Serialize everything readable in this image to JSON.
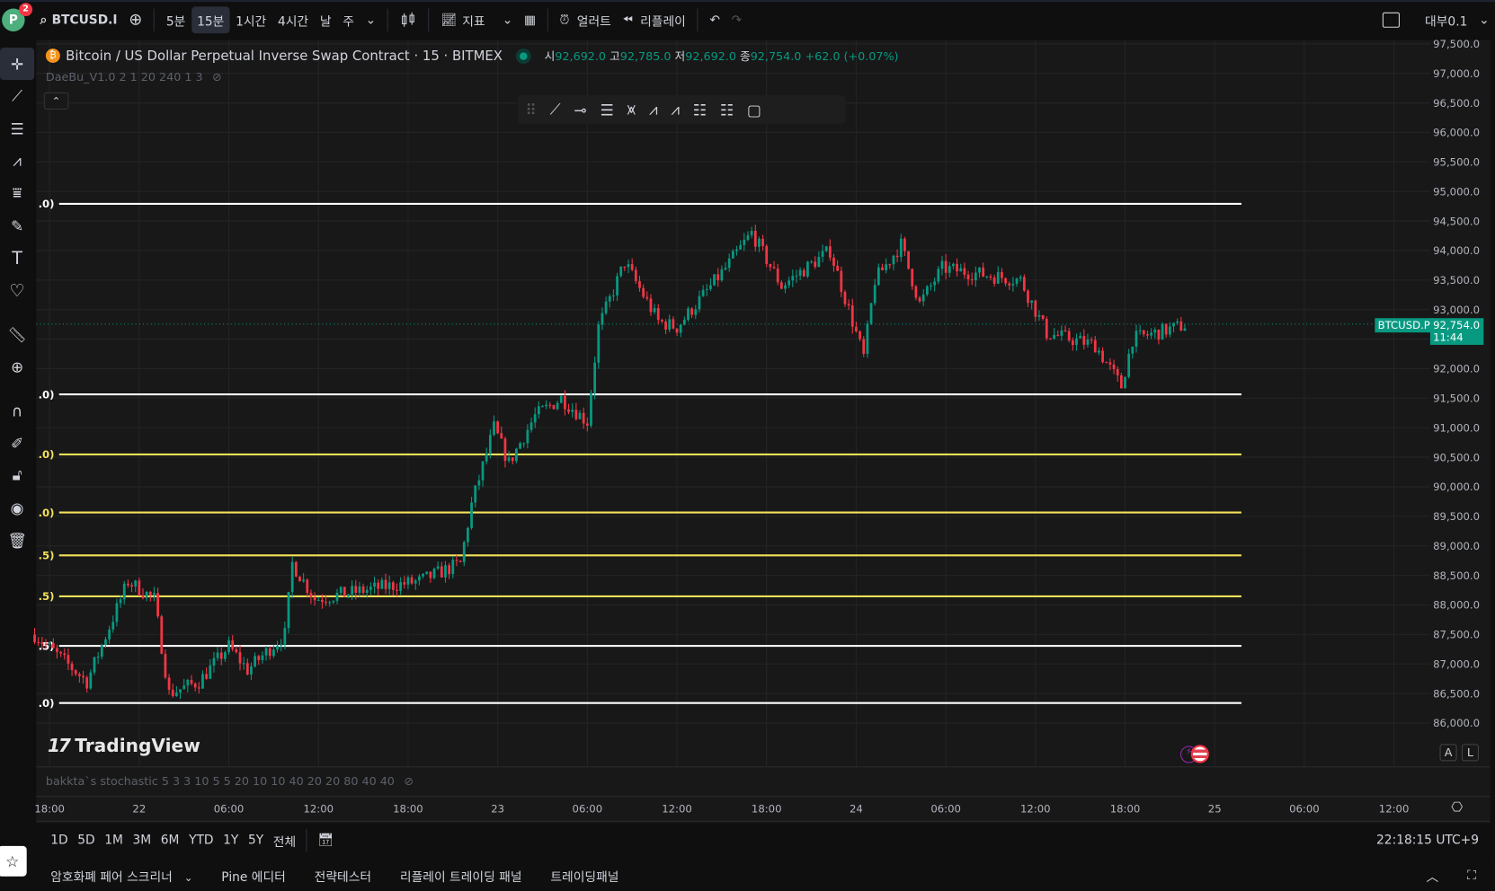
{
  "topbar": {
    "avatar": "P",
    "badge": "2",
    "symbol": "BTCUSD.I",
    "intervals": [
      "5분",
      "15분",
      "1시간",
      "4시간",
      "날",
      "주"
    ],
    "active_interval": "15분",
    "indicators": "지표",
    "alert": "얼러트",
    "replay": "리플레이",
    "layout_name": "대부0.1"
  },
  "legend": {
    "title": "Bitcoin / US Dollar Perpetual Inverse Swap Contract · 15 · BITMEX",
    "o_label": "시",
    "o": "92,692.0",
    "h_label": "고",
    "h": "92,785.0",
    "l_label": "저",
    "l": "92,692.0",
    "c_label": "종",
    "c": "92,754.0",
    "change": "+62.0 (+0.07%)"
  },
  "indicator1": "DaeBu_V1.0 2 1 20 240 1 3",
  "indicator2": "bakkta`s stochastic 5 3 3 10 5 5 20 10 10 40 20 20 80 40 40",
  "watermark": "TradingView",
  "price_label": {
    "symbol": "BTCUSD.P",
    "price": "92,754.0",
    "countdown": "11:44"
  },
  "scale_buttons": [
    "A",
    "L"
  ],
  "range_buttons": [
    "1D",
    "5D",
    "1M",
    "3M",
    "6M",
    "YTD",
    "1Y",
    "5Y",
    "전체"
  ],
  "clock": "22:18:15 UTC+9",
  "bottom_tabs": [
    "암호화폐 페어 스크리너",
    "Pine 에디터",
    "전략테스터",
    "리플레이 트레이딩 패널",
    "트레이딩패널"
  ],
  "colors": {
    "up": "#089981",
    "down": "#f23645",
    "bg": "#181818",
    "grid": "#242424",
    "level_white": "#ffffff",
    "level_yellow": "#f5e15a"
  },
  "chart_data": {
    "type": "candlestick",
    "interval": "15",
    "y_ticks": [
      "97,500.0",
      "97,000.0",
      "96,500.0",
      "96,000.0",
      "95,500.0",
      "95,000.0",
      "94,500.0",
      "94,000.0",
      "93,500.0",
      "93,000.0",
      "92,500.0",
      "92,000.0",
      "91,500.0",
      "91,000.0",
      "90,500.0",
      "90,000.0",
      "89,500.0",
      "89,000.0",
      "88,500.0",
      "88,000.0",
      "87,500.0",
      "87,000.0",
      "86,500.0",
      "86,000.0"
    ],
    "ylim": [
      86000,
      97500
    ],
    "x_ticks": [
      "18:00",
      "22",
      "06:00",
      "12:00",
      "18:00",
      "23",
      "06:00",
      "12:00",
      "18:00",
      "24",
      "06:00",
      "12:00",
      "18:00",
      "25",
      "06:00",
      "12:00"
    ],
    "last_price": 92754,
    "levels": [
      {
        "price": 94790,
        "color": "white",
        "label": ".0)"
      },
      {
        "price": 91565,
        "color": "white",
        "label": ".0)"
      },
      {
        "price": 90548,
        "color": "yellow",
        "label": ".0)"
      },
      {
        "price": 89565,
        "color": "yellow",
        "label": ".0)"
      },
      {
        "price": 88839,
        "color": "yellow",
        "label": ".5)"
      },
      {
        "price": 88145,
        "color": "yellow",
        "label": ".5)"
      },
      {
        "price": 87306,
        "color": "white",
        "label": ".5)"
      },
      {
        "price": 86339,
        "color": "white",
        "label": ".0)"
      }
    ],
    "approx_close_path": [
      [
        "21 17:00",
        87500
      ],
      [
        "21 20:30",
        86700
      ],
      [
        "21 23:15",
        88400
      ],
      [
        "22 01:00",
        88100
      ],
      [
        "22 02:00",
        86500
      ],
      [
        "22 04:00",
        86700
      ],
      [
        "22 06:00",
        87300
      ],
      [
        "22 07:15",
        86900
      ],
      [
        "22 09:45",
        87500
      ],
      [
        "22 10:15",
        88700
      ],
      [
        "22 11:45",
        88100
      ],
      [
        "22 16:15",
        88300
      ],
      [
        "22 18:45",
        88400
      ],
      [
        "22 21:30",
        88700
      ],
      [
        "22 22:15",
        89700
      ],
      [
        "22 23:45",
        91000
      ],
      [
        "23 00:45",
        90400
      ],
      [
        "23 02:30",
        91200
      ],
      [
        "23 04:15",
        91500
      ],
      [
        "23 06:00",
        91100
      ],
      [
        "23 06:45",
        92700
      ],
      [
        "23 08:30",
        93800
      ],
      [
        "23 10:45",
        92800
      ],
      [
        "23 12:00",
        92700
      ],
      [
        "23 15:15",
        93700
      ],
      [
        "23 17:00",
        94300
      ],
      [
        "23 19:00",
        93400
      ],
      [
        "23 22:15",
        94000
      ],
      [
        "23 23:30",
        93000
      ],
      [
        "24 00:30",
        92200
      ],
      [
        "24 01:15",
        93500
      ],
      [
        "24 03:00",
        94100
      ],
      [
        "24 04:15",
        93100
      ],
      [
        "24 05:45",
        93700
      ],
      [
        "24 11:00",
        93500
      ],
      [
        "24 12:45",
        92600
      ],
      [
        "24 16:00",
        92400
      ],
      [
        "24 17:45",
        91700
      ],
      [
        "24 18:30",
        92500
      ],
      [
        "24 22:15",
        92754
      ]
    ]
  }
}
